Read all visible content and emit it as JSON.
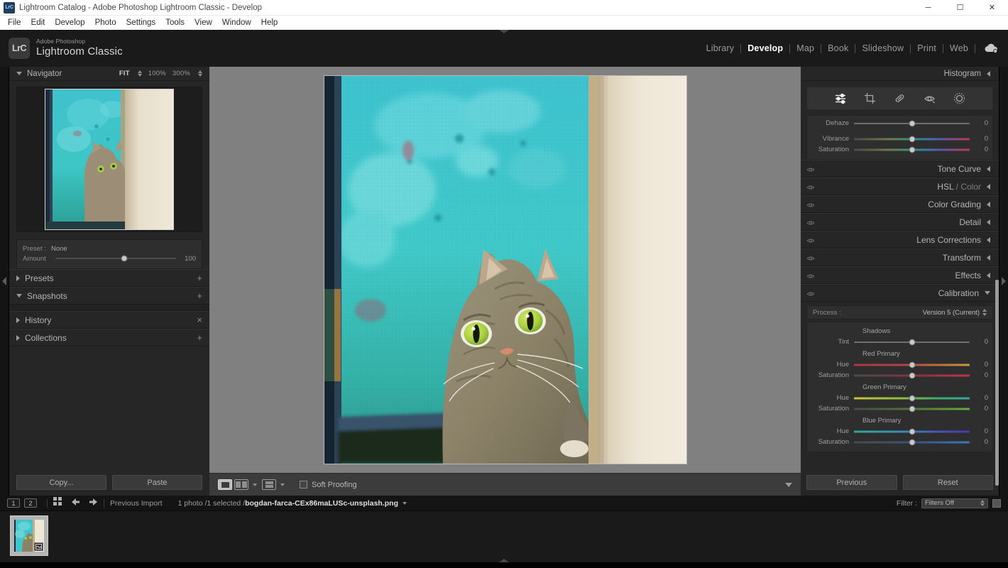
{
  "window": {
    "title": "Lightroom Catalog - Adobe Photoshop Lightroom Classic - Develop",
    "app_icon": "LrC",
    "minimize": "─",
    "maximize": "☐",
    "close": "✕"
  },
  "menubar": {
    "items": [
      "File",
      "Edit",
      "Develop",
      "Photo",
      "Settings",
      "Tools",
      "View",
      "Window",
      "Help"
    ]
  },
  "brand": {
    "badge": "LrC",
    "superscript": "Adobe Photoshop",
    "name": "Lightroom Classic"
  },
  "modules": {
    "items": [
      {
        "label": "Library",
        "active": false
      },
      {
        "label": "Develop",
        "active": true
      },
      {
        "label": "Map",
        "active": false
      },
      {
        "label": "Book",
        "active": false
      },
      {
        "label": "Slideshow",
        "active": false
      },
      {
        "label": "Print",
        "active": false
      },
      {
        "label": "Web",
        "active": false
      }
    ],
    "cloud_icon": "cloud-sync-icon"
  },
  "left_panel": {
    "navigator": {
      "title": "Navigator",
      "fit": "FIT",
      "zoom_100": "100%",
      "zoom_300": "300%"
    },
    "preset_box": {
      "preset_label": "Preset :",
      "preset_value": "None",
      "amount_label": "Amount",
      "amount_value": "100"
    },
    "sections": [
      {
        "label": "Presets",
        "action": "+",
        "expanded": false
      },
      {
        "label": "Snapshots",
        "action": "+",
        "expanded": true
      },
      {
        "label": "History",
        "action": "×",
        "expanded": false
      },
      {
        "label": "Collections",
        "action": "+",
        "expanded": false
      }
    ],
    "copy_label": "Copy...",
    "paste_label": "Paste"
  },
  "center": {
    "toolbar": {
      "loupe_icon": "loupe-view-icon",
      "before_after_lr_icon": "before-after-left-right-icon",
      "before_after_tb_icon": "before-after-top-bottom-icon",
      "soft_proofing_label": "Soft Proofing",
      "soft_proofing_checked": false,
      "toolbar_chevron": "chevron-down-icon"
    }
  },
  "right_panel": {
    "histogram_title": "Histogram",
    "tools": [
      {
        "name": "adjustment-sliders-icon",
        "active": true
      },
      {
        "name": "crop-overlay-icon",
        "active": false
      },
      {
        "name": "spot-removal-icon",
        "active": false
      },
      {
        "name": "red-eye-correction-icon",
        "active": false
      },
      {
        "name": "masking-icon",
        "active": false
      }
    ],
    "basic_sliders": [
      {
        "label": "Dehaze",
        "value": "0",
        "type": "plain"
      },
      {
        "label": "Vibrance",
        "value": "0",
        "type": "rainbow"
      },
      {
        "label": "Saturation",
        "value": "0",
        "type": "rainbow"
      }
    ],
    "sections": [
      {
        "label": "Tone Curve",
        "expanded": false
      },
      {
        "label": "HSL",
        "label_dim": " / Color",
        "expanded": false
      },
      {
        "label": "Color Grading",
        "expanded": false
      },
      {
        "label": "Detail",
        "expanded": false
      },
      {
        "label": "Lens Corrections",
        "expanded": false
      },
      {
        "label": "Transform",
        "expanded": false
      },
      {
        "label": "Effects",
        "expanded": false
      },
      {
        "label": "Calibration",
        "expanded": true
      }
    ],
    "calibration": {
      "process_label": "Process :",
      "process_value": "Version 5 (Current)",
      "groups": [
        {
          "title": "Shadows",
          "sliders": [
            {
              "label": "Tint",
              "value": "0",
              "type": "plain"
            }
          ]
        },
        {
          "title": "Red Primary",
          "sliders": [
            {
              "label": "Hue",
              "value": "0",
              "type": "red-hue"
            },
            {
              "label": "Saturation",
              "value": "0",
              "type": "red-sat"
            }
          ]
        },
        {
          "title": "Green Primary",
          "sliders": [
            {
              "label": "Hue",
              "value": "0",
              "type": "green-hue"
            },
            {
              "label": "Saturation",
              "value": "0",
              "type": "green-sat"
            }
          ]
        },
        {
          "title": "Blue Primary",
          "sliders": [
            {
              "label": "Hue",
              "value": "0",
              "type": "blue-hue"
            },
            {
              "label": "Saturation",
              "value": "0",
              "type": "blue-sat"
            }
          ]
        }
      ]
    },
    "previous_label": "Previous",
    "reset_label": "Reset"
  },
  "filmstrip": {
    "page_1": "1",
    "page_2": "2",
    "grid_icon": "grid-view-icon",
    "back_icon": "arrow-left-icon",
    "forward_icon": "arrow-right-icon",
    "source_label": "Previous Import",
    "count_label": "1 photo /1 selected /",
    "filename": "bogdan-farca-CEx86maLUSc-unsplash.png",
    "filter_label": "Filter :",
    "filter_value": "Filters Off"
  },
  "colors": {
    "panel_bg": "#262626",
    "canvas_bg": "#808080",
    "chrome_bg": "#1a1a1a",
    "text": "#b4b4b4",
    "accent_white": "#ffffff"
  }
}
